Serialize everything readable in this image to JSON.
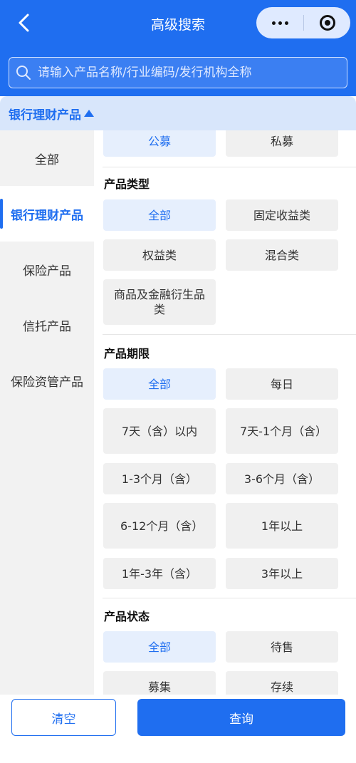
{
  "header": {
    "title": "高级搜索",
    "back_icon": "chevron-left-icon",
    "more_icon": "more-dots-icon",
    "target_icon": "target-icon"
  },
  "search": {
    "placeholder": "请输入产品名称/行业编码/发行机构全称",
    "icon": "search-icon"
  },
  "category_bar": {
    "label": "银行理财产品",
    "icon": "triangle-up-icon"
  },
  "sidebar": {
    "items": [
      {
        "label": "全部",
        "active": false
      },
      {
        "label": "银行理财产品",
        "active": true
      },
      {
        "label": "保险产品",
        "active": false
      },
      {
        "label": "信托产品",
        "active": false
      },
      {
        "label": "保险资管产品",
        "active": false
      }
    ]
  },
  "filters": {
    "offering": {
      "options": [
        {
          "label": "公募",
          "selected": true
        },
        {
          "label": "私募",
          "selected": false
        }
      ]
    },
    "product_type": {
      "title": "产品类型",
      "options": [
        {
          "label": "全部",
          "selected": true
        },
        {
          "label": "固定收益类",
          "selected": false
        },
        {
          "label": "权益类",
          "selected": false
        },
        {
          "label": "混合类",
          "selected": false
        },
        {
          "label": "商品及金融衍生品类",
          "selected": false
        }
      ]
    },
    "product_term": {
      "title": "产品期限",
      "options": [
        {
          "label": "全部",
          "selected": true
        },
        {
          "label": "每日",
          "selected": false
        },
        {
          "label": "7天（含）以内",
          "selected": false
        },
        {
          "label": "7天-1个月（含）",
          "selected": false
        },
        {
          "label": "1-3个月（含）",
          "selected": false
        },
        {
          "label": "3-6个月（含）",
          "selected": false
        },
        {
          "label": "6-12个月（含）",
          "selected": false
        },
        {
          "label": "1年以上",
          "selected": false
        },
        {
          "label": "1年-3年（含）",
          "selected": false
        },
        {
          "label": "3年以上",
          "selected": false
        }
      ]
    },
    "product_status": {
      "title": "产品状态",
      "options": [
        {
          "label": "全部",
          "selected": true
        },
        {
          "label": "待售",
          "selected": false
        },
        {
          "label": "募集",
          "selected": false
        },
        {
          "label": "存续",
          "selected": false
        }
      ]
    }
  },
  "footer": {
    "clear_label": "清空",
    "query_label": "查询"
  },
  "colors": {
    "primary": "#1f6ef0",
    "selected_bg": "#e6effd",
    "chip_bg": "#f0f0f0",
    "sidebar_bg": "#f2f2f2"
  }
}
